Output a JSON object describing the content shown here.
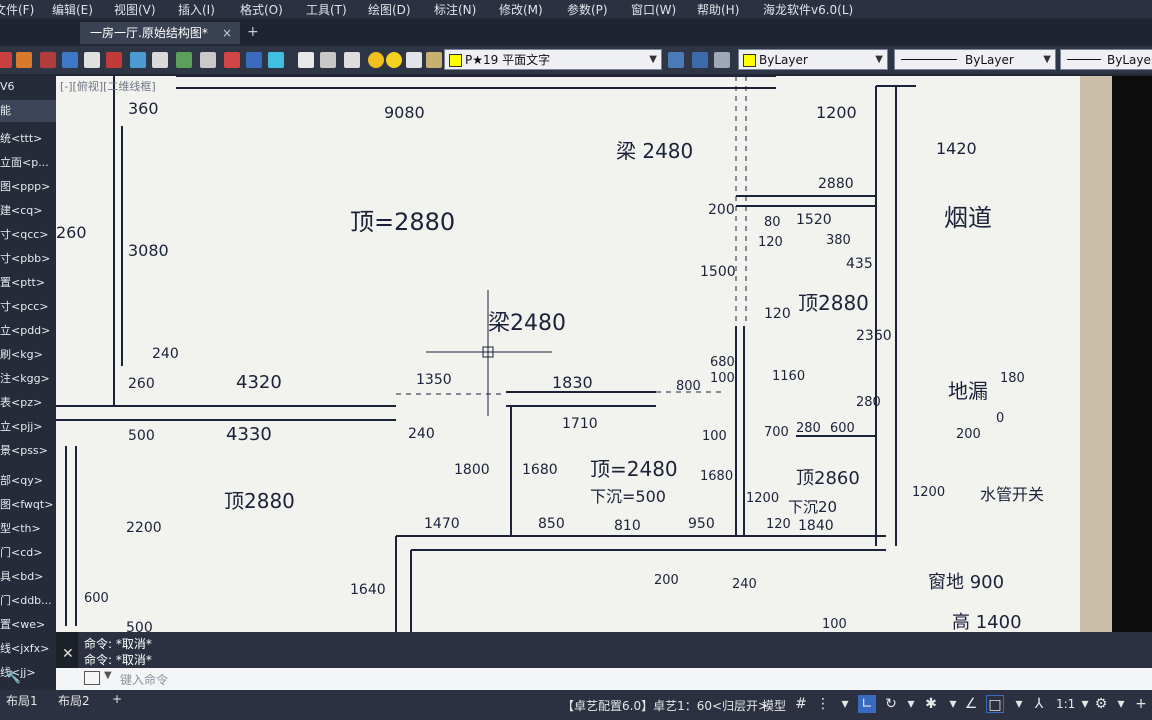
{
  "menu": [
    "文件(F)",
    "编辑(E)",
    "视图(V)",
    "插入(I)",
    "格式(O)",
    "工具(T)",
    "绘图(D)",
    "标注(N)",
    "修改(M)",
    "参数(P)",
    "窗口(W)",
    "帮助(H)",
    "海龙软件v6.0(L)"
  ],
  "tabs": {
    "doc_title": "一房一厅.原始结构图*",
    "close": "×",
    "add": "+"
  },
  "toolbar": {
    "text_style": "P★19 平面文字",
    "color_layer": "ByLayer",
    "linetype": "ByLayer",
    "lineweight": "ByLayer",
    "colors": {
      "yellow": "#ffff00",
      "bg": "#2e3544"
    }
  },
  "left_panel": {
    "title": "V6",
    "items": [
      "能",
      "统<ttt>",
      "立面<p...",
      "图<ppp>",
      "建<cq>",
      "寸<qcc>",
      "寸<pbb>",
      "置<ptt>",
      "寸<pcc>",
      "立<pdd>",
      "刷<kg>",
      "注<kgg>",
      "表<pz>",
      "立<pjj>",
      "景<pss>",
      "",
      "部<qy>",
      "图<fwqt>",
      "型<th>",
      "门<cd>",
      "具<bd>",
      "门<ddb...",
      "置<we>",
      "线<jxfx>",
      "线<jj>"
    ]
  },
  "viewport_label": "[-][俯视][二维线框]",
  "drawing": {
    "texts": [
      "9080",
      "360",
      "梁 2480",
      "1200",
      "1420",
      "2880",
      "烟道",
      "200",
      "80",
      "1520",
      "120",
      "380",
      "435",
      "顶=2880",
      "3080",
      "260",
      "1500",
      "顶2880",
      "梁2480",
      "120",
      "2360",
      "240",
      "260",
      "4320",
      "1350",
      "1830",
      "800",
      "680",
      "100",
      "1160",
      "地漏",
      "180",
      "0",
      "200",
      "280",
      "500",
      "4330",
      "240",
      "1710",
      "100",
      "700",
      "280",
      "600",
      "1800",
      "1680",
      "顶=2480",
      "下沉=500",
      "1680",
      "顶2860",
      "1200",
      "下沉20",
      "1200",
      "顶2880",
      "水管开关",
      "2200",
      "1470",
      "850",
      "810",
      "950",
      "120",
      "1840",
      "1640",
      "200",
      "240",
      "窗地 900",
      "600",
      "100",
      "高 1400",
      "500"
    ]
  },
  "command": {
    "line1": "命令: *取消*",
    "line2": "命令: *取消*",
    "placeholder": "键入命令"
  },
  "status": {
    "layouts": [
      "布局1",
      "布局2"
    ],
    "add": "+",
    "config": "【卓艺配置6.0】卓艺1：60<归层开>",
    "model": "模型",
    "scale": "1:1"
  }
}
